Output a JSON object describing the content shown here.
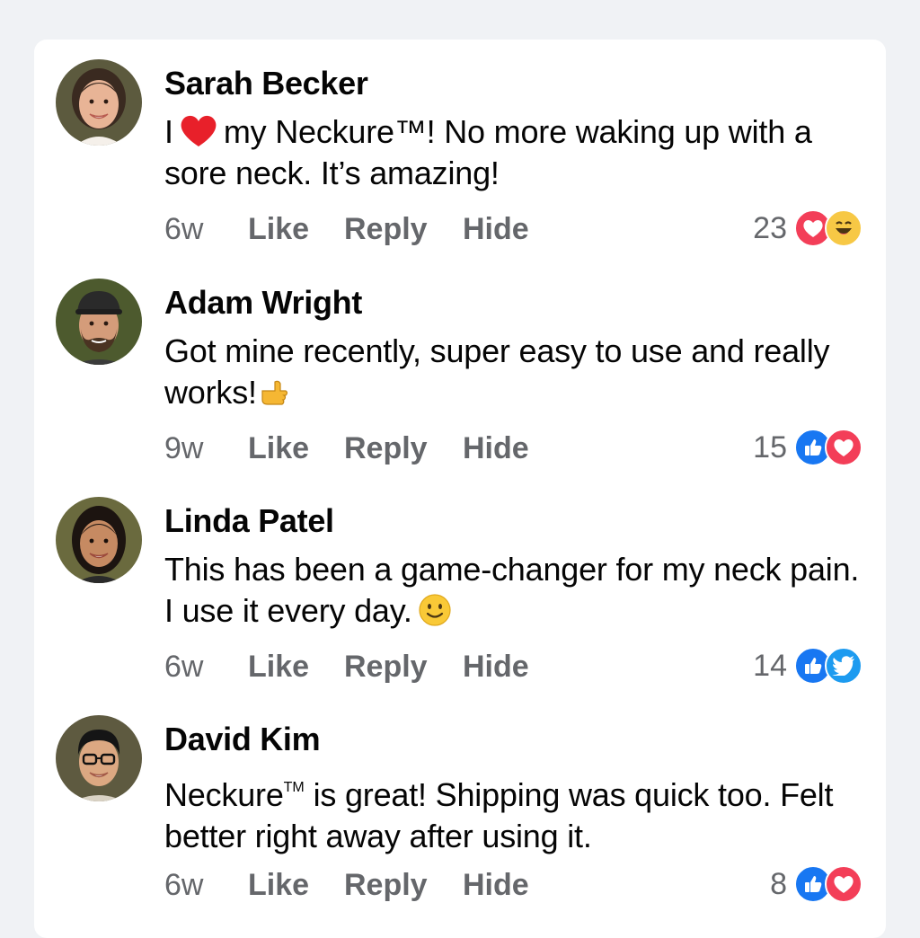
{
  "comments": [
    {
      "author": "Sarah Becker",
      "avatar_icon": "avatar-woman-brown-hair",
      "text_before": "I",
      "text_emoji": "red-heart-emoji",
      "text_after": "my Neckure™! No more waking up with a sore neck. It’s amazing!",
      "time": "6w",
      "like_label": "Like",
      "reply_label": "Reply",
      "hide_label": "Hide",
      "reaction_count": "23",
      "reactions": [
        "love-reaction-icon",
        "haha-reaction-icon"
      ]
    },
    {
      "author": "Adam Wright",
      "avatar_icon": "avatar-man-cap-beard",
      "text_before": "Got mine recently, super easy to use and really works!",
      "text_emoji": "pointing-hand-emoji",
      "time": "9w",
      "like_label": "Like",
      "reply_label": "Reply",
      "hide_label": "Hide",
      "reaction_count": "15",
      "reactions": [
        "like-reaction-icon",
        "love-reaction-icon"
      ]
    },
    {
      "author": "Linda Patel",
      "avatar_icon": "avatar-woman-dark-hair",
      "text_before": "This has been a game-changer for my neck pain. I use it every day.",
      "text_emoji": "smiling-face-emoji",
      "time": "6w",
      "like_label": "Like",
      "reply_label": "Reply",
      "hide_label": "Hide",
      "reaction_count": "14",
      "reactions": [
        "like-reaction-icon",
        "twitter-bird-reaction-icon"
      ]
    },
    {
      "author": "David Kim",
      "avatar_icon": "avatar-man-glasses",
      "text_before": "Neckure",
      "text_tm": "TM",
      "text_after": "is great! Shipping was quick too. Felt better right away after using it.",
      "time": "6w",
      "like_label": "Like",
      "reply_label": "Reply",
      "hide_label": "Hide",
      "reaction_count": "8",
      "reactions": [
        "like-reaction-icon",
        "love-reaction-icon"
      ]
    }
  ],
  "colors": {
    "background": "#f0f2f5",
    "card": "#ffffff",
    "name_text": "#050505",
    "meta_text": "#65676b",
    "love": "#f33e58",
    "like": "#1877f2",
    "haha": "#f7c845"
  }
}
